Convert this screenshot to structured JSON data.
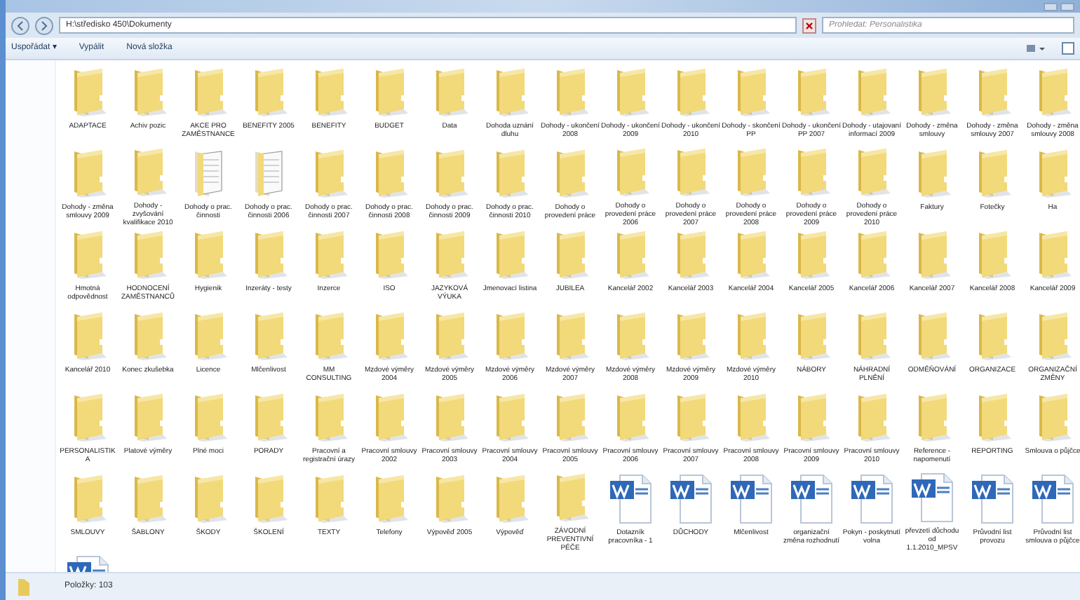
{
  "window": {
    "address": "H:\\středisko 450\\Dokumenty",
    "search": {
      "placeholder": "Prohledat: Personalistika"
    }
  },
  "toolbar": [
    {
      "label": "Uspořádat ▾"
    },
    {
      "label": "Vypálit"
    },
    {
      "label": "Nová složka"
    }
  ],
  "items": [
    {
      "kind": "folder",
      "label": "ADAPTACE"
    },
    {
      "kind": "folder",
      "label": "Achiv pozic"
    },
    {
      "kind": "folder",
      "label": "AKCE PRO ZAMĚSTNANCE"
    },
    {
      "kind": "folder",
      "label": "BENEFITY 2005"
    },
    {
      "kind": "folder",
      "label": "BENEFITY"
    },
    {
      "kind": "folder",
      "label": "BUDGET"
    },
    {
      "kind": "folder",
      "label": "Data"
    },
    {
      "kind": "folder",
      "label": "Dohoda uznání dluhu"
    },
    {
      "kind": "folder",
      "label": "Dohody - ukončení 2008"
    },
    {
      "kind": "folder",
      "label": "Dohody - ukončení 2009"
    },
    {
      "kind": "folder",
      "label": "Dohody - ukončení 2010"
    },
    {
      "kind": "folder",
      "label": "Dohody - skončení PP"
    },
    {
      "kind": "folder",
      "label": "Dohody - ukončení PP 2007"
    },
    {
      "kind": "folder",
      "label": "Dohody - utajovaní informací 2009"
    },
    {
      "kind": "folder",
      "label": "Dohody - změna smlouvy"
    },
    {
      "kind": "folder",
      "label": "Dohody - změna smlouvy 2007"
    },
    {
      "kind": "folder",
      "label": "Dohody - změna smlouvy 2008"
    },
    {
      "kind": "folder",
      "label": "Dohody - změna smlouvy 2009"
    },
    {
      "kind": "folder",
      "label": "Dohody - zvyšování kvalifikace 2010"
    },
    {
      "kind": "folder-docs",
      "label": "Dohody o prac. činnosti"
    },
    {
      "kind": "folder-docs",
      "label": "Dohody o prac. činnosti 2006"
    },
    {
      "kind": "folder",
      "label": "Dohody o prac. činnosti 2007"
    },
    {
      "kind": "folder",
      "label": "Dohody o prac. činnosti 2008"
    },
    {
      "kind": "folder",
      "label": "Dohody o prac. činnosti 2009"
    },
    {
      "kind": "folder",
      "label": "Dohody o prac. činnosti 2010"
    },
    {
      "kind": "folder",
      "label": "Dohody o provedení práce"
    },
    {
      "kind": "folder",
      "label": "Dohody o provedení práce 2006"
    },
    {
      "kind": "folder",
      "label": "Dohody o provedení práce 2007"
    },
    {
      "kind": "folder",
      "label": "Dohody o provedení práce 2008"
    },
    {
      "kind": "folder",
      "label": "Dohody o provedení práce 2009"
    },
    {
      "kind": "folder",
      "label": "Dohody o provedení práce 2010"
    },
    {
      "kind": "folder",
      "label": "Faktury"
    },
    {
      "kind": "folder",
      "label": "Fotečky"
    },
    {
      "kind": "folder",
      "label": "Ha"
    },
    {
      "kind": "folder",
      "label": "Hmotná odpovědnost"
    },
    {
      "kind": "folder",
      "label": "HODNOCENÍ ZAMĚSTNANCŮ"
    },
    {
      "kind": "folder",
      "label": "Hygienik"
    },
    {
      "kind": "folder",
      "label": "Inzeráty - testy"
    },
    {
      "kind": "folder",
      "label": "Inzerce"
    },
    {
      "kind": "folder",
      "label": "ISO"
    },
    {
      "kind": "folder",
      "label": "JAZYKOVÁ VÝUKA"
    },
    {
      "kind": "folder",
      "label": "Jmenovací listina"
    },
    {
      "kind": "folder",
      "label": "JUBILEA"
    },
    {
      "kind": "folder",
      "label": "Kancelář 2002"
    },
    {
      "kind": "folder",
      "label": "Kancelář 2003"
    },
    {
      "kind": "folder",
      "label": "Kancelář 2004"
    },
    {
      "kind": "folder",
      "label": "Kancelář 2005"
    },
    {
      "kind": "folder",
      "label": "Kancelář 2006"
    },
    {
      "kind": "folder",
      "label": "Kancelář 2007"
    },
    {
      "kind": "folder",
      "label": "Kancelář 2008"
    },
    {
      "kind": "folder",
      "label": "Kancelář 2009"
    },
    {
      "kind": "folder",
      "label": "Kancelář 2010"
    },
    {
      "kind": "folder",
      "label": "Konec zkušebka"
    },
    {
      "kind": "folder",
      "label": "Licence"
    },
    {
      "kind": "folder",
      "label": "Mlčenlivost"
    },
    {
      "kind": "folder",
      "label": "MM CONSULTING"
    },
    {
      "kind": "folder",
      "label": "Mzdové výměry 2004"
    },
    {
      "kind": "folder",
      "label": "Mzdové výměry 2005"
    },
    {
      "kind": "folder",
      "label": "Mzdové výměry 2006"
    },
    {
      "kind": "folder",
      "label": "Mzdové výměry 2007"
    },
    {
      "kind": "folder",
      "label": "Mzdové výměry 2008"
    },
    {
      "kind": "folder",
      "label": "Mzdové výměry 2009"
    },
    {
      "kind": "folder",
      "label": "Mzdové výměry 2010"
    },
    {
      "kind": "folder",
      "label": "NÁBORY"
    },
    {
      "kind": "folder",
      "label": "NÁHRADNÍ PLNĚNÍ"
    },
    {
      "kind": "folder",
      "label": "ODMĚŇOVÁNÍ"
    },
    {
      "kind": "folder",
      "label": "ORGANIZACE"
    },
    {
      "kind": "folder",
      "label": "ORGANIZAČNÍ ZMĚNY"
    },
    {
      "kind": "folder",
      "label": "PERSONALISTIKA"
    },
    {
      "kind": "folder",
      "label": "Platové výměry"
    },
    {
      "kind": "folder",
      "label": "Plné moci"
    },
    {
      "kind": "folder",
      "label": "PORADY"
    },
    {
      "kind": "folder",
      "label": "Pracovní a registrační úrazy"
    },
    {
      "kind": "folder",
      "label": "Pracovní smlouvy 2002"
    },
    {
      "kind": "folder",
      "label": "Pracovní smlouvy 2003"
    },
    {
      "kind": "folder",
      "label": "Pracovní smlouvy 2004"
    },
    {
      "kind": "folder",
      "label": "Pracovní smlouvy 2005"
    },
    {
      "kind": "folder",
      "label": "Pracovní smlouvy 2006"
    },
    {
      "kind": "folder",
      "label": "Pracovní smlouvy 2007"
    },
    {
      "kind": "folder",
      "label": "Pracovní smlouvy 2008"
    },
    {
      "kind": "folder",
      "label": "Pracovní smlouvy 2009"
    },
    {
      "kind": "folder",
      "label": "Pracovní smlouvy 2010"
    },
    {
      "kind": "folder",
      "label": "Reference - napomenutí"
    },
    {
      "kind": "folder",
      "label": "REPORTING"
    },
    {
      "kind": "folder",
      "label": "Smlouva o půjčce"
    },
    {
      "kind": "folder",
      "label": "SMLOUVY"
    },
    {
      "kind": "folder",
      "label": "ŠABLONY"
    },
    {
      "kind": "folder",
      "label": "ŠKODY"
    },
    {
      "kind": "folder",
      "label": "ŠKOLENÍ"
    },
    {
      "kind": "folder",
      "label": "TEXTY"
    },
    {
      "kind": "folder",
      "label": "Telefony"
    },
    {
      "kind": "folder",
      "label": "Výpověď 2005"
    },
    {
      "kind": "folder",
      "label": "Výpověď"
    },
    {
      "kind": "folder",
      "label": "ZÁVODNÍ PREVENTIVNÍ PÉČE"
    },
    {
      "kind": "document",
      "label": "Dotazník pracovníka - 1"
    },
    {
      "kind": "document",
      "label": "DŮCHODY"
    },
    {
      "kind": "document",
      "label": "Mlčenlivost"
    },
    {
      "kind": "document",
      "label": "organizační změna rozhodnutí"
    },
    {
      "kind": "document",
      "label": "Pokyn - poskytnutí volna"
    },
    {
      "kind": "document",
      "label": "převzetí důchodu od 1.1.2010_MPSV"
    },
    {
      "kind": "document",
      "label": "Průvodní list provozu"
    },
    {
      "kind": "document",
      "label": "Průvodní list smlouva o půjčce"
    },
    {
      "kind": "document"
    }
  ],
  "status_bar": {
    "count": "Položky: 103"
  }
}
